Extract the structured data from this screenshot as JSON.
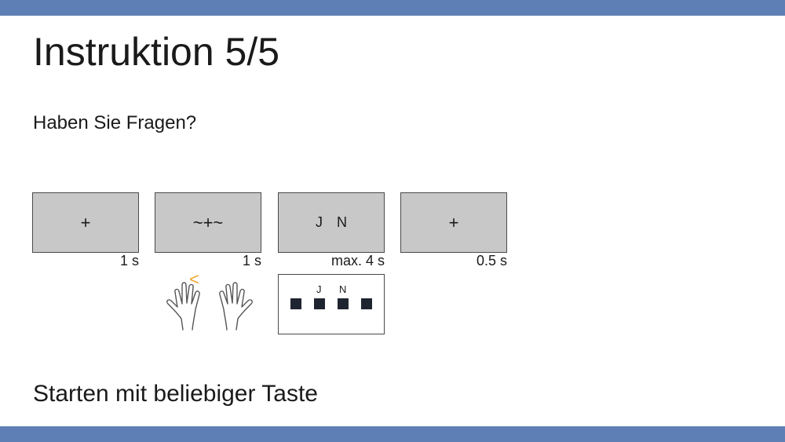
{
  "slide": {
    "title": "Instruktion 5/5",
    "question": "Haben Sie Fragen?",
    "start_prompt": "Starten mit beliebiger Taste"
  },
  "trial_sequence": [
    {
      "display": "+",
      "duration": "1 s"
    },
    {
      "display": "~+~",
      "duration": "1 s"
    },
    {
      "display_left": "J",
      "display_right": "N",
      "duration": "max. 4 s"
    },
    {
      "display": "+",
      "duration": "0.5 s"
    }
  ],
  "cue": {
    "symbol": "<",
    "color": "#f0a830"
  },
  "keyboard": {
    "label_left": "J",
    "label_right": "N"
  },
  "colors": {
    "accent_bar": "#5e7fb5",
    "screen_fill": "#c8c8c8",
    "key_fill": "#1f2530"
  }
}
